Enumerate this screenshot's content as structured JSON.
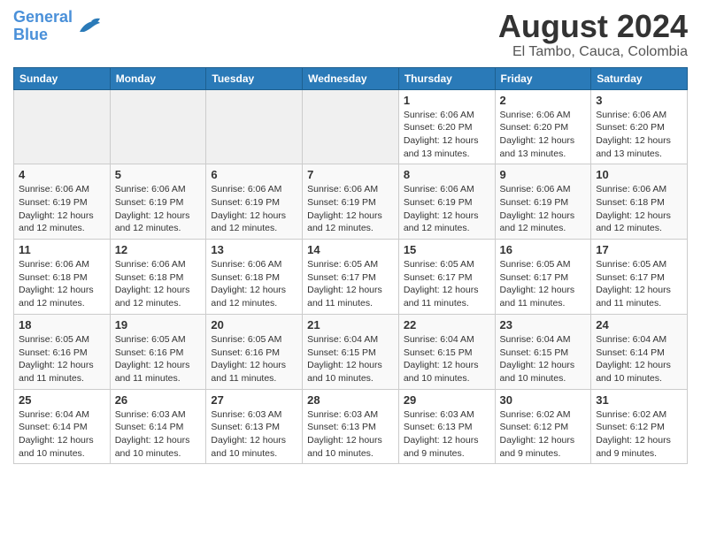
{
  "header": {
    "logo_line1": "General",
    "logo_line2": "Blue",
    "title": "August 2024",
    "subtitle": "El Tambo, Cauca, Colombia"
  },
  "calendar": {
    "days_of_week": [
      "Sunday",
      "Monday",
      "Tuesday",
      "Wednesday",
      "Thursday",
      "Friday",
      "Saturday"
    ],
    "weeks": [
      [
        {
          "day": "",
          "info": ""
        },
        {
          "day": "",
          "info": ""
        },
        {
          "day": "",
          "info": ""
        },
        {
          "day": "",
          "info": ""
        },
        {
          "day": "1",
          "info": "Sunrise: 6:06 AM\nSunset: 6:20 PM\nDaylight: 12 hours\nand 13 minutes."
        },
        {
          "day": "2",
          "info": "Sunrise: 6:06 AM\nSunset: 6:20 PM\nDaylight: 12 hours\nand 13 minutes."
        },
        {
          "day": "3",
          "info": "Sunrise: 6:06 AM\nSunset: 6:20 PM\nDaylight: 12 hours\nand 13 minutes."
        }
      ],
      [
        {
          "day": "4",
          "info": "Sunrise: 6:06 AM\nSunset: 6:19 PM\nDaylight: 12 hours\nand 12 minutes."
        },
        {
          "day": "5",
          "info": "Sunrise: 6:06 AM\nSunset: 6:19 PM\nDaylight: 12 hours\nand 12 minutes."
        },
        {
          "day": "6",
          "info": "Sunrise: 6:06 AM\nSunset: 6:19 PM\nDaylight: 12 hours\nand 12 minutes."
        },
        {
          "day": "7",
          "info": "Sunrise: 6:06 AM\nSunset: 6:19 PM\nDaylight: 12 hours\nand 12 minutes."
        },
        {
          "day": "8",
          "info": "Sunrise: 6:06 AM\nSunset: 6:19 PM\nDaylight: 12 hours\nand 12 minutes."
        },
        {
          "day": "9",
          "info": "Sunrise: 6:06 AM\nSunset: 6:19 PM\nDaylight: 12 hours\nand 12 minutes."
        },
        {
          "day": "10",
          "info": "Sunrise: 6:06 AM\nSunset: 6:18 PM\nDaylight: 12 hours\nand 12 minutes."
        }
      ],
      [
        {
          "day": "11",
          "info": "Sunrise: 6:06 AM\nSunset: 6:18 PM\nDaylight: 12 hours\nand 12 minutes."
        },
        {
          "day": "12",
          "info": "Sunrise: 6:06 AM\nSunset: 6:18 PM\nDaylight: 12 hours\nand 12 minutes."
        },
        {
          "day": "13",
          "info": "Sunrise: 6:06 AM\nSunset: 6:18 PM\nDaylight: 12 hours\nand 12 minutes."
        },
        {
          "day": "14",
          "info": "Sunrise: 6:05 AM\nSunset: 6:17 PM\nDaylight: 12 hours\nand 11 minutes."
        },
        {
          "day": "15",
          "info": "Sunrise: 6:05 AM\nSunset: 6:17 PM\nDaylight: 12 hours\nand 11 minutes."
        },
        {
          "day": "16",
          "info": "Sunrise: 6:05 AM\nSunset: 6:17 PM\nDaylight: 12 hours\nand 11 minutes."
        },
        {
          "day": "17",
          "info": "Sunrise: 6:05 AM\nSunset: 6:17 PM\nDaylight: 12 hours\nand 11 minutes."
        }
      ],
      [
        {
          "day": "18",
          "info": "Sunrise: 6:05 AM\nSunset: 6:16 PM\nDaylight: 12 hours\nand 11 minutes."
        },
        {
          "day": "19",
          "info": "Sunrise: 6:05 AM\nSunset: 6:16 PM\nDaylight: 12 hours\nand 11 minutes."
        },
        {
          "day": "20",
          "info": "Sunrise: 6:05 AM\nSunset: 6:16 PM\nDaylight: 12 hours\nand 11 minutes."
        },
        {
          "day": "21",
          "info": "Sunrise: 6:04 AM\nSunset: 6:15 PM\nDaylight: 12 hours\nand 10 minutes."
        },
        {
          "day": "22",
          "info": "Sunrise: 6:04 AM\nSunset: 6:15 PM\nDaylight: 12 hours\nand 10 minutes."
        },
        {
          "day": "23",
          "info": "Sunrise: 6:04 AM\nSunset: 6:15 PM\nDaylight: 12 hours\nand 10 minutes."
        },
        {
          "day": "24",
          "info": "Sunrise: 6:04 AM\nSunset: 6:14 PM\nDaylight: 12 hours\nand 10 minutes."
        }
      ],
      [
        {
          "day": "25",
          "info": "Sunrise: 6:04 AM\nSunset: 6:14 PM\nDaylight: 12 hours\nand 10 minutes."
        },
        {
          "day": "26",
          "info": "Sunrise: 6:03 AM\nSunset: 6:14 PM\nDaylight: 12 hours\nand 10 minutes."
        },
        {
          "day": "27",
          "info": "Sunrise: 6:03 AM\nSunset: 6:13 PM\nDaylight: 12 hours\nand 10 minutes."
        },
        {
          "day": "28",
          "info": "Sunrise: 6:03 AM\nSunset: 6:13 PM\nDaylight: 12 hours\nand 10 minutes."
        },
        {
          "day": "29",
          "info": "Sunrise: 6:03 AM\nSunset: 6:13 PM\nDaylight: 12 hours\nand 9 minutes."
        },
        {
          "day": "30",
          "info": "Sunrise: 6:02 AM\nSunset: 6:12 PM\nDaylight: 12 hours\nand 9 minutes."
        },
        {
          "day": "31",
          "info": "Sunrise: 6:02 AM\nSunset: 6:12 PM\nDaylight: 12 hours\nand 9 minutes."
        }
      ]
    ]
  }
}
